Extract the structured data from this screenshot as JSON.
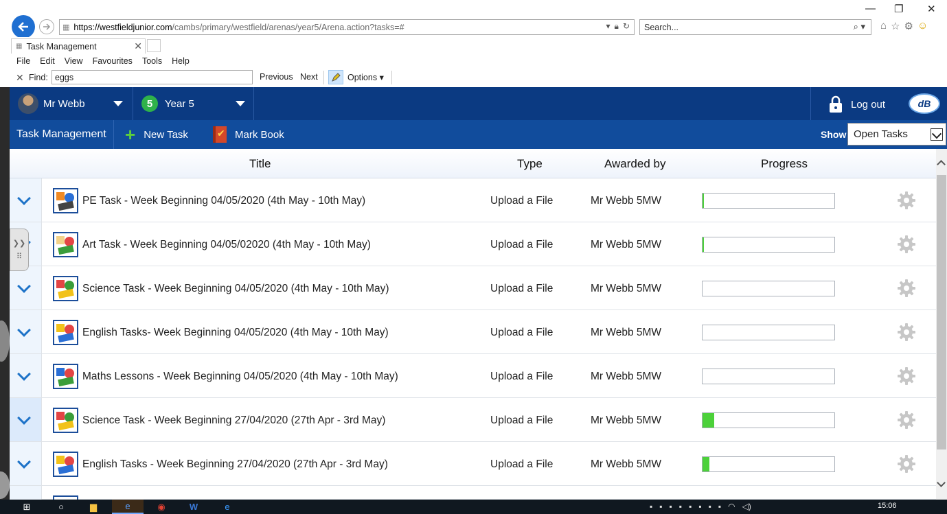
{
  "browser": {
    "url_domain": "https://westfieldjunior.com",
    "url_path": "/cambs/primary/westfield/arenas/year5/Arena.action?tasks=#",
    "search_placeholder": "Search...",
    "tab_title": "Task Management",
    "menu": [
      "File",
      "Edit",
      "View",
      "Favourites",
      "Tools",
      "Help"
    ],
    "find": {
      "label": "Find:",
      "value": "eggs",
      "previous": "Previous",
      "next": "Next",
      "options": "Options"
    }
  },
  "header": {
    "user_name": "Mr Webb",
    "year_badge": "5",
    "year_name": "Year 5",
    "logout_label": "Log out",
    "logo_text": "dB"
  },
  "toolbar": {
    "title": "Task Management",
    "new_task": "New Task",
    "mark_book": "Mark Book",
    "show_label": "Show",
    "show_value": "Open Tasks"
  },
  "table": {
    "columns": {
      "title": "Title",
      "type": "Type",
      "awarded_by": "Awarded by",
      "progress": "Progress"
    },
    "rows": [
      {
        "title": "PE Task - Week Beginning 04/05/2020 (4th May - 10th May)",
        "type": "Upload a File",
        "awarded_by": "Mr Webb 5MW",
        "progress": 0.01,
        "icon": "pe-sports-icon"
      },
      {
        "title": "Art Task - Week Beginning 04/05/02020 (4th May - 10th May)",
        "type": "Upload a File",
        "awarded_by": "Mr Webb 5MW",
        "progress": 0.01,
        "icon": "art-palette-icon"
      },
      {
        "title": "Science Task - Week Beginning 04/05/2020 (4th May - 10th May)",
        "type": "Upload a File",
        "awarded_by": "Mr Webb 5MW",
        "progress": 0,
        "icon": "science-icon"
      },
      {
        "title": "English Tasks- Week Beginning 04/05/2020 (4th May - 10th May)",
        "type": "Upload a File",
        "awarded_by": "Mr Webb 5MW",
        "progress": 0,
        "icon": "english-icon"
      },
      {
        "title": "Maths Lessons - Week Beginning 04/05/2020 (4th May - 10th May)",
        "type": "Upload a File",
        "awarded_by": "Mr Webb 5MW",
        "progress": 0,
        "icon": "maths-icon"
      },
      {
        "title": "Science Task - Week Beginning 27/04/2020 (27th Apr - 3rd May)",
        "type": "Upload a File",
        "awarded_by": "Mr Webb 5MW",
        "progress": 0.09,
        "icon": "science-icon"
      },
      {
        "title": "English Tasks - Week Beginning 27/04/2020 (27th Apr - 3rd May)",
        "type": "Upload a File",
        "awarded_by": "Mr Webb 5MW",
        "progress": 0.05,
        "icon": "english-icon"
      }
    ]
  },
  "taskbar": {
    "clock": "15:06"
  },
  "colors": {
    "header_dark": "#0b3a82",
    "header_sub": "#114c9c",
    "progress_fill": "#4cd13a",
    "chevron": "#1e73c8"
  }
}
